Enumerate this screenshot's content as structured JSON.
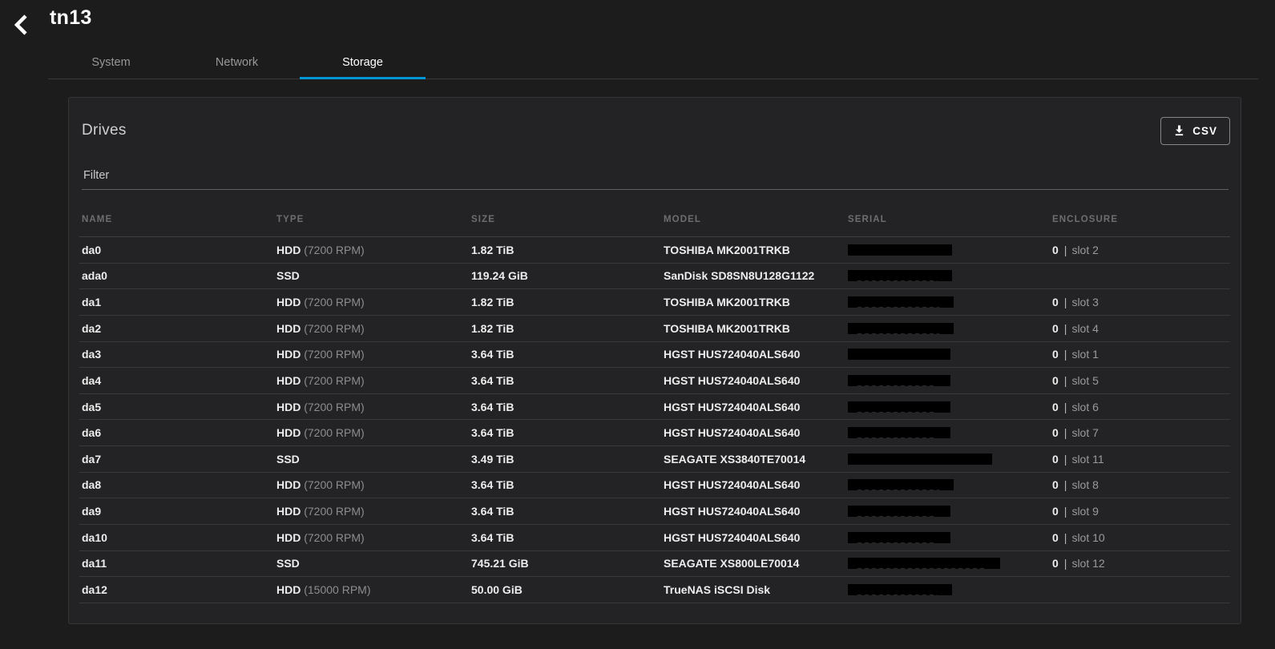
{
  "colors": {
    "accent": "#0095d5",
    "redaction": "#000000"
  },
  "page": {
    "title": "tn13",
    "back_icon": "chevron-left-icon"
  },
  "tabs": [
    {
      "label": "System",
      "active": false
    },
    {
      "label": "Network",
      "active": false
    },
    {
      "label": "Storage",
      "active": true
    }
  ],
  "panel": {
    "title": "Drives",
    "csv_button_label": "CSV",
    "csv_button_icon": "download-icon",
    "filter_placeholder": "Filter",
    "table": {
      "columns": [
        "NAME",
        "TYPE",
        "SIZE",
        "MODEL",
        "SERIAL",
        "ENCLOSURE"
      ],
      "rows": [
        {
          "name": "da0",
          "type": "HDD",
          "type_detail": "(7200 RPM)",
          "size": "1.82 TiB",
          "model": "TOSHIBA MK2001TRKB",
          "serial_redacted": true,
          "serial_bar_width": 130,
          "serial_remnant": false,
          "enclosure_id": "0",
          "enclosure_slot": "slot 2"
        },
        {
          "name": "ada0",
          "type": "SSD",
          "type_detail": "",
          "size": "119.24 GiB",
          "model": "SanDisk SD8SN8U128G1122",
          "serial_redacted": true,
          "serial_bar_width": 130,
          "serial_remnant": true,
          "enclosure_id": "",
          "enclosure_slot": ""
        },
        {
          "name": "da1",
          "type": "HDD",
          "type_detail": "(7200 RPM)",
          "size": "1.82 TiB",
          "model": "TOSHIBA MK2001TRKB",
          "serial_redacted": true,
          "serial_bar_width": 132,
          "serial_remnant": true,
          "enclosure_id": "0",
          "enclosure_slot": "slot 3"
        },
        {
          "name": "da2",
          "type": "HDD",
          "type_detail": "(7200 RPM)",
          "size": "1.82 TiB",
          "model": "TOSHIBA MK2001TRKB",
          "serial_redacted": true,
          "serial_bar_width": 132,
          "serial_remnant": true,
          "enclosure_id": "0",
          "enclosure_slot": "slot 4"
        },
        {
          "name": "da3",
          "type": "HDD",
          "type_detail": "(7200 RPM)",
          "size": "3.64 TiB",
          "model": "HGST HUS724040ALS640",
          "serial_redacted": true,
          "serial_bar_width": 128,
          "serial_remnant": false,
          "enclosure_id": "0",
          "enclosure_slot": "slot 1"
        },
        {
          "name": "da4",
          "type": "HDD",
          "type_detail": "(7200 RPM)",
          "size": "3.64 TiB",
          "model": "HGST HUS724040ALS640",
          "serial_redacted": true,
          "serial_bar_width": 128,
          "serial_remnant": true,
          "enclosure_id": "0",
          "enclosure_slot": "slot 5"
        },
        {
          "name": "da5",
          "type": "HDD",
          "type_detail": "(7200 RPM)",
          "size": "3.64 TiB",
          "model": "HGST HUS724040ALS640",
          "serial_redacted": true,
          "serial_bar_width": 128,
          "serial_remnant": true,
          "enclosure_id": "0",
          "enclosure_slot": "slot 6"
        },
        {
          "name": "da6",
          "type": "HDD",
          "type_detail": "(7200 RPM)",
          "size": "3.64 TiB",
          "model": "HGST HUS724040ALS640",
          "serial_redacted": true,
          "serial_bar_width": 128,
          "serial_remnant": true,
          "enclosure_id": "0",
          "enclosure_slot": "slot 7"
        },
        {
          "name": "da7",
          "type": "SSD",
          "type_detail": "",
          "size": "3.49 TiB",
          "model": "SEAGATE XS3840TE70014",
          "serial_redacted": true,
          "serial_bar_width": 180,
          "serial_remnant": false,
          "enclosure_id": "0",
          "enclosure_slot": "slot 11"
        },
        {
          "name": "da8",
          "type": "HDD",
          "type_detail": "(7200 RPM)",
          "size": "3.64 TiB",
          "model": "HGST HUS724040ALS640",
          "serial_redacted": true,
          "serial_bar_width": 132,
          "serial_remnant": true,
          "enclosure_id": "0",
          "enclosure_slot": "slot 8"
        },
        {
          "name": "da9",
          "type": "HDD",
          "type_detail": "(7200 RPM)",
          "size": "3.64 TiB",
          "model": "HGST HUS724040ALS640",
          "serial_redacted": true,
          "serial_bar_width": 128,
          "serial_remnant": true,
          "enclosure_id": "0",
          "enclosure_slot": "slot 9"
        },
        {
          "name": "da10",
          "type": "HDD",
          "type_detail": "(7200 RPM)",
          "size": "3.64 TiB",
          "model": "HGST HUS724040ALS640",
          "serial_redacted": true,
          "serial_bar_width": 128,
          "serial_remnant": true,
          "enclosure_id": "0",
          "enclosure_slot": "slot 10"
        },
        {
          "name": "da11",
          "type": "SSD",
          "type_detail": "",
          "size": "745.21 GiB",
          "model": "SEAGATE XS800LE70014",
          "serial_redacted": true,
          "serial_bar_width": 190,
          "serial_remnant": true,
          "enclosure_id": "0",
          "enclosure_slot": "slot 12"
        },
        {
          "name": "da12",
          "type": "HDD",
          "type_detail": "(15000 RPM)",
          "size": "50.00 GiB",
          "model": "TrueNAS iSCSI Disk",
          "serial_redacted": true,
          "serial_bar_width": 130,
          "serial_remnant": true,
          "enclosure_id": "",
          "enclosure_slot": ""
        }
      ]
    }
  }
}
